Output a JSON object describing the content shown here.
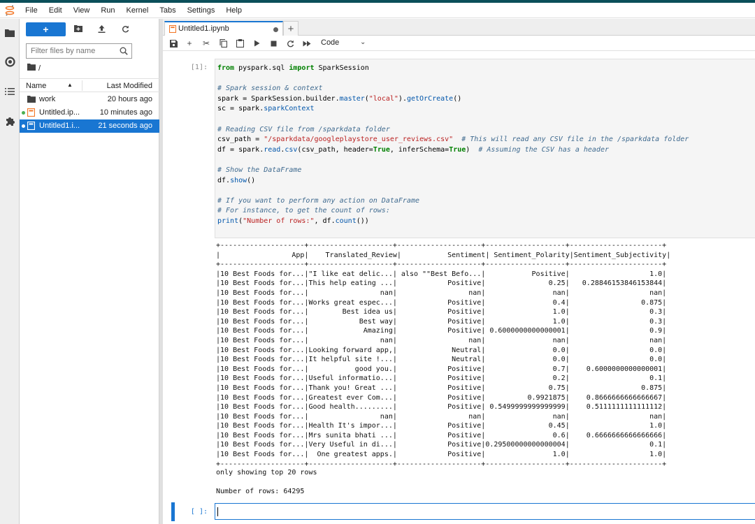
{
  "menubar": {
    "items": [
      "File",
      "Edit",
      "View",
      "Run",
      "Kernel",
      "Tabs",
      "Settings",
      "Help"
    ]
  },
  "filebrowser": {
    "new_label": "+",
    "filter_placeholder": "Filter files by name",
    "breadcrumb": "/",
    "col_name": "Name",
    "col_modified": "Last Modified",
    "files": [
      {
        "name": "work",
        "modified": "20 hours ago",
        "type": "folder",
        "running": false,
        "selected": false
      },
      {
        "name": "Untitled.ip...",
        "modified": "10 minutes ago",
        "type": "notebook",
        "running": true,
        "selected": false
      },
      {
        "name": "Untitled1.i...",
        "modified": "21 seconds ago",
        "type": "notebook",
        "running": true,
        "selected": true
      }
    ]
  },
  "tab": {
    "title": "Untitled1.ipynb",
    "add_label": "+"
  },
  "toolbar": {
    "cell_type": "Code"
  },
  "cell": {
    "prompt": "[1]:",
    "code": [
      [
        [
          "kw",
          "from"
        ],
        [
          "",
          "  pyspark.sql "
        ],
        [
          "kw",
          "import"
        ],
        [
          "",
          " SparkSession"
        ]
      ],
      [],
      [
        [
          "cm",
          "# Spark session & context"
        ]
      ],
      [
        [
          "",
          " spark = SparkSession.builder."
        ],
        [
          "bi",
          "master"
        ],
        [
          "",
          "("
        ],
        [
          "st",
          "\"local\""
        ],
        [
          "",
          ")."
        ],
        [
          "bi",
          "getOrCreate"
        ],
        [
          "",
          "()"
        ]
      ],
      [
        [
          "",
          " sc = spark."
        ],
        [
          "bi",
          "sparkContext"
        ]
      ],
      [],
      [
        [
          "cm",
          "# Reading CSV file from /sparkdata folder"
        ]
      ],
      [
        [
          "",
          " csv_path = "
        ],
        [
          "st",
          "\"/sparkdata/googleplaystore_user_reviews.csv\""
        ],
        [
          "",
          "  "
        ],
        [
          "cm",
          "# This will read any CSV file in the /sparkdata folder"
        ]
      ],
      [
        [
          "",
          " df = spark."
        ],
        [
          "bi",
          "read"
        ],
        [
          "",
          "."
        ],
        [
          "bi",
          "csv"
        ],
        [
          "",
          "(csv_path, header="
        ],
        [
          "kw",
          "True"
        ],
        [
          "",
          ", inferSchema="
        ],
        [
          "kw",
          "True"
        ],
        [
          "",
          ")  "
        ],
        [
          "cm",
          "# Assuming the CSV has a header"
        ]
      ],
      [],
      [
        [
          "cm",
          "# Show the DataFrame"
        ]
      ],
      [
        [
          "",
          " df."
        ],
        [
          "bi",
          "show"
        ],
        [
          "",
          "()"
        ]
      ],
      [],
      [
        [
          "cm",
          "# If you want to perform any action on DataFrame"
        ]
      ],
      [
        [
          "cm",
          "# For instance, to get the count of rows:"
        ]
      ],
      [
        [
          "bi",
          "print"
        ],
        [
          "",
          "("
        ],
        [
          "st",
          "\"Number of rows:\""
        ],
        [
          "",
          ", df."
        ],
        [
          "bi",
          "count"
        ],
        [
          "",
          "())"
        ]
      ]
    ]
  },
  "output": {
    "table_lines": [
      "+--------------------+--------------------+--------------------+-------------------+----------------------+",
      "|                 App|    Translated_Review|           Sentiment| Sentiment_Polarity|Sentiment_Subjectivity|",
      "+--------------------+--------------------+--------------------+-------------------+----------------------+",
      "|10 Best Foods for...|\"I like eat delic...| also \"\"Best Befo...|           Positive|                   1.0|",
      "|10 Best Foods for...|This help eating ...|            Positive|               0.25|   0.28846153846153844|",
      "|10 Best Foods for...|                 nan|                 nan|                nan|                   nan|",
      "|10 Best Foods for...|Works great espec...|            Positive|                0.4|                 0.875|",
      "|10 Best Foods for...|        Best idea us|            Positive|                1.0|                   0.3|",
      "|10 Best Foods for...|            Best way|            Positive|                1.0|                   0.3|",
      "|10 Best Foods for...|             Amazing|            Positive| 0.6000000000000001|                   0.9|",
      "|10 Best Foods for...|                 nan|                 nan|                nan|                   nan|",
      "|10 Best Foods for...|Looking forward app,|             Neutral|                0.0|                   0.0|",
      "|10 Best Foods for...|It helpful site !...|             Neutral|                0.0|                   0.0|",
      "|10 Best Foods for...|           good you.|            Positive|                0.7|    0.6000000000000001|",
      "|10 Best Foods for...|Useful informatio...|            Positive|                0.2|                   0.1|",
      "|10 Best Foods for...|Thank you! Great ...|            Positive|               0.75|                 0.875|",
      "|10 Best Foods for...|Greatest ever Com...|            Positive|          0.9921875|    0.8666666666666667|",
      "|10 Best Foods for...|Good health.........|            Positive| 0.5499999999999999|    0.5111111111111112|",
      "|10 Best Foods for...|                 nan|                 nan|                nan|                   nan|",
      "|10 Best Foods for...|Health It's impor...|            Positive|               0.45|                   1.0|",
      "|10 Best Foods for...|Mrs sunita bhati ...|            Positive|                0.6|    0.6666666666666666|",
      "|10 Best Foods for...|Very Useful in di...|            Positive|0.29500000000000004|                   0.1|",
      "|10 Best Foods for...|  One greatest apps.|            Positive|                1.0|                   1.0|",
      "+--------------------+--------------------+--------------------+-------------------+----------------------+"
    ],
    "note": "only showing top 20 rows",
    "row_count": "Number of rows: 64295"
  },
  "empty_cell": {
    "prompt": "[ ]:"
  }
}
